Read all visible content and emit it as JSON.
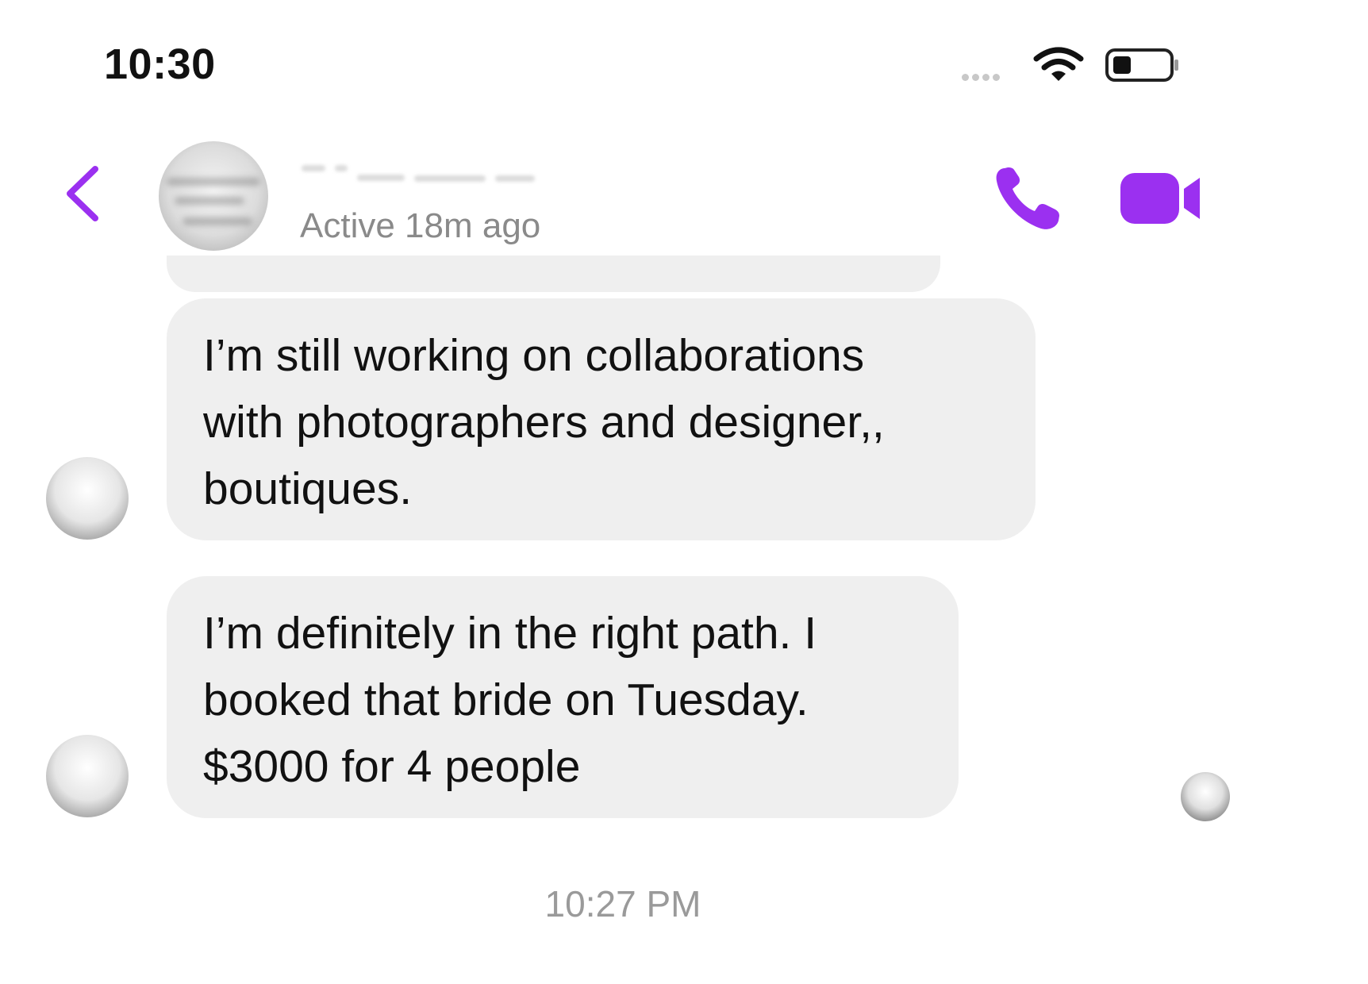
{
  "status_bar": {
    "time": "10:30"
  },
  "header": {
    "active_status": "Active 18m ago",
    "icons": {
      "back": "chevron-left-icon",
      "call": "phone-icon",
      "video": "video-camera-icon"
    },
    "accent_color": "#9b30f0"
  },
  "messages": [
    {
      "lines": [
        "I’m still working on collaborations",
        "with photographers and designer,,",
        "boutiques."
      ]
    },
    {
      "lines": [
        "I’m definitely in the right path. I",
        "booked that bride on Tuesday.",
        "$3000 for 4 people"
      ]
    }
  ],
  "timestamp": "10:27 PM",
  "colors": {
    "bubble_background": "#efefef",
    "text": "#111111",
    "muted_text": "#8a8a8a"
  }
}
